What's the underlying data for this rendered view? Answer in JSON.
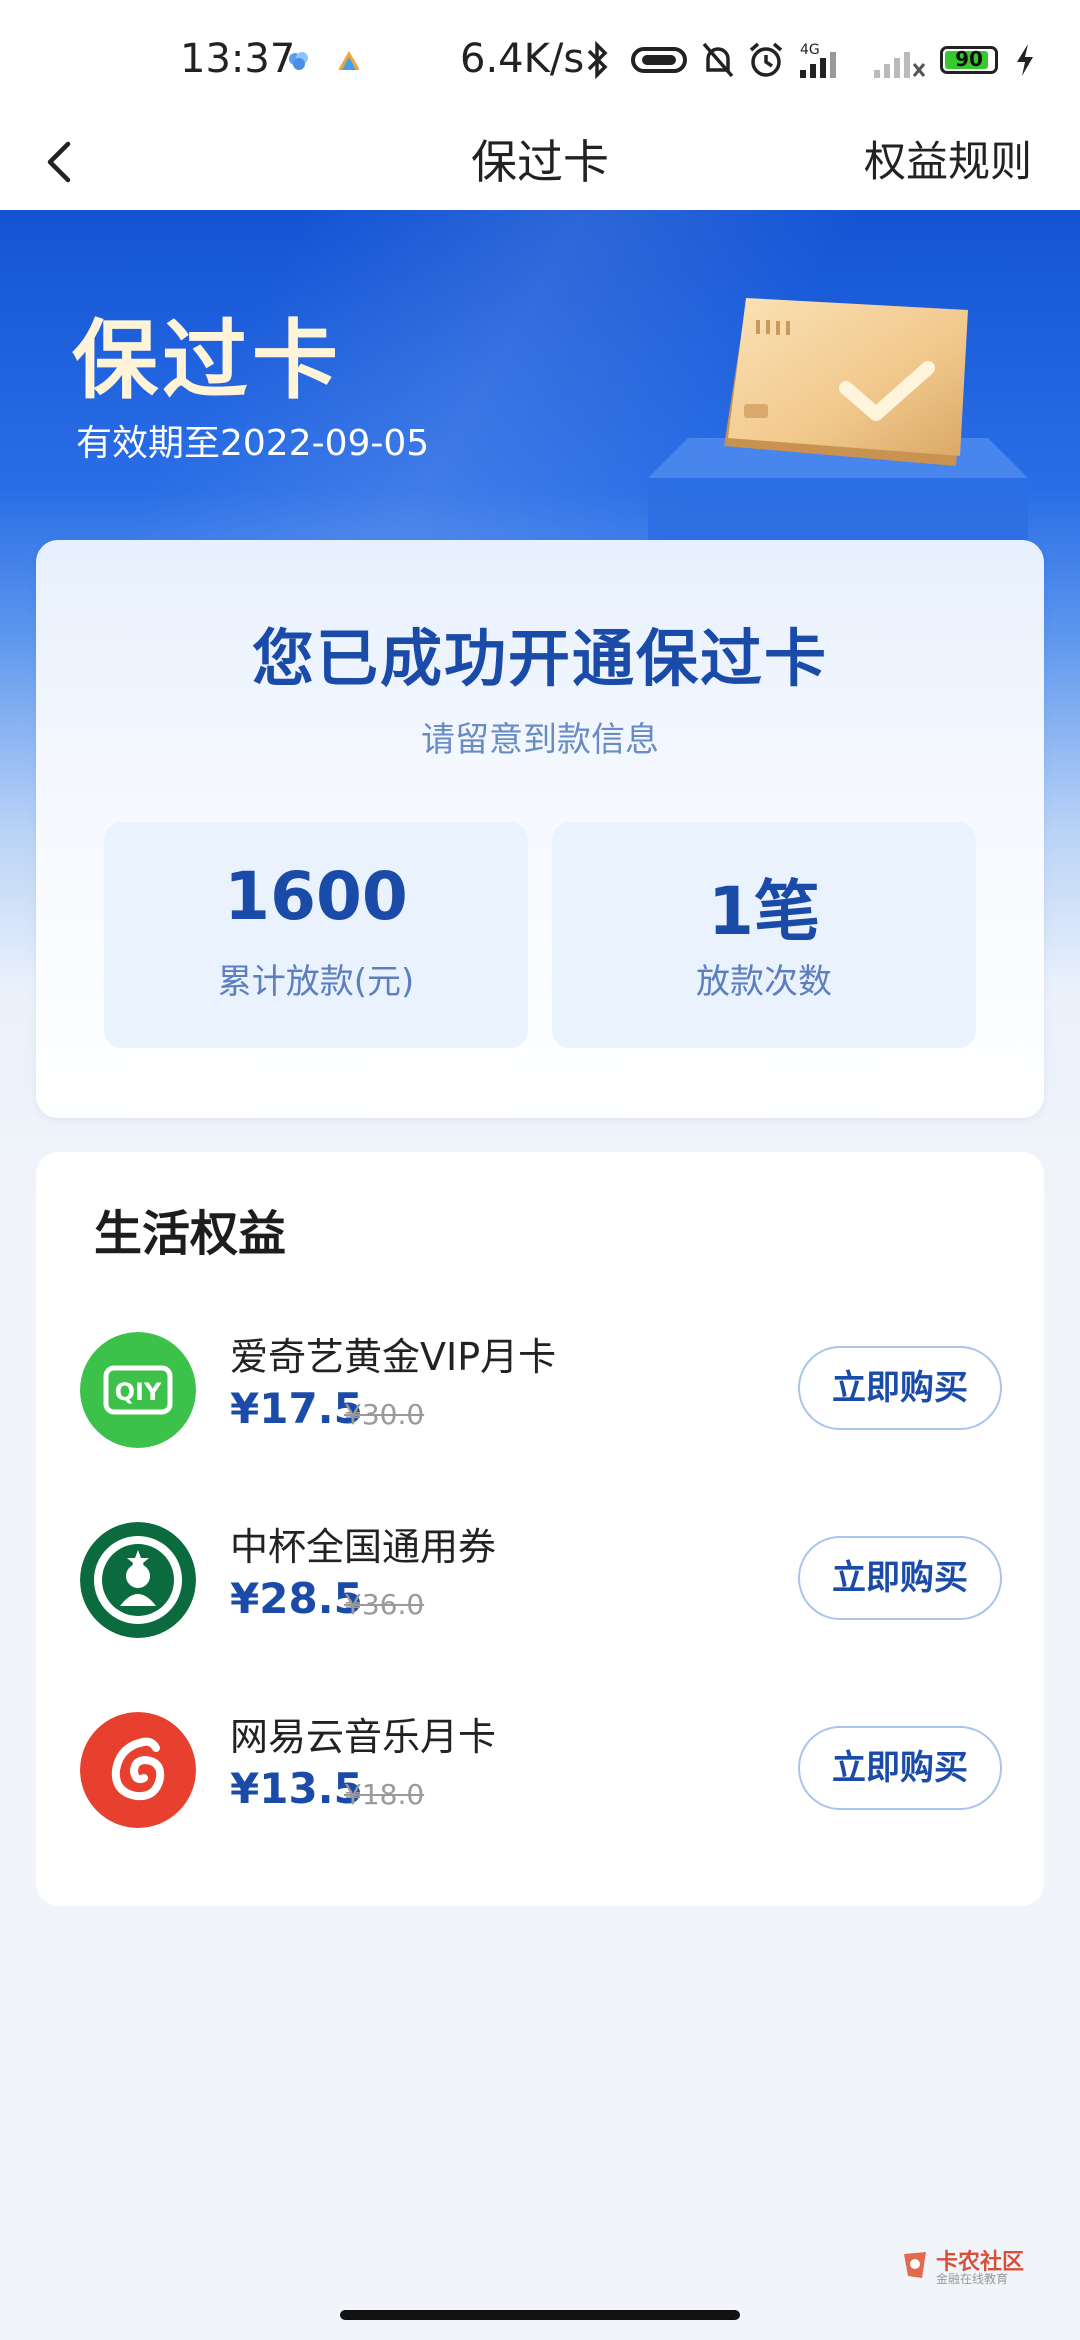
{
  "status_bar": {
    "time": "13:37",
    "net_speed": "6.4K/s",
    "network": "4G",
    "battery": "90",
    "battery_fraction": 0.9
  },
  "nav": {
    "title": "保过卡",
    "rules_label": "权益规则"
  },
  "hero": {
    "title": "保过卡",
    "expiry": "有效期至2022-09-05"
  },
  "success": {
    "title": "您已成功开通保过卡",
    "subtitle": "请留意到款信息",
    "stats": [
      {
        "value": "1600",
        "label": "累计放款(元)"
      },
      {
        "value": "1笔",
        "label": "放款次数"
      }
    ]
  },
  "benefits": {
    "title": "生活权益",
    "items": [
      {
        "name": "爱奇艺黄金VIP月卡",
        "price": "¥17.5",
        "original_price": "¥30.0",
        "button": "立即购买",
        "icon": "iqiyi-logo",
        "color": "#3cc24a"
      },
      {
        "name": "中杯全国通用券",
        "price": "¥28.5",
        "original_price": "¥36.0",
        "button": "立即购买",
        "icon": "starbucks-logo",
        "color": "#0b6b3f"
      },
      {
        "name": "网易云音乐月卡",
        "price": "¥13.5",
        "original_price": "¥18.0",
        "button": "立即购买",
        "icon": "netease-music-logo",
        "color": "#e8402f"
      }
    ]
  },
  "watermark": {
    "text": "卡农社区",
    "sub": "金融在线教育"
  },
  "colors": {
    "accent": "#1a4ba8",
    "hero_blue": "#1454d4",
    "button_border": "#a9c5ee"
  }
}
